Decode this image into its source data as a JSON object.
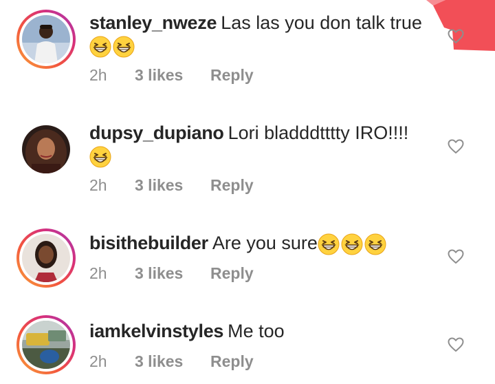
{
  "comments": [
    {
      "username": "stanley_nweze",
      "text": "Las las you don talk true",
      "emoji_count": 2,
      "time": "2h",
      "likes": "3 likes",
      "reply": "Reply",
      "avatar_ring": true
    },
    {
      "username": "dupsy_dupiano",
      "text": "Lori bladddtttty IRO!!!!",
      "emoji_count": 1,
      "time": "2h",
      "likes": "3 likes",
      "reply": "Reply",
      "avatar_ring": false
    },
    {
      "username": "bisithebuilder",
      "text": "Are you sure",
      "emoji_count": 3,
      "time": "2h",
      "likes": "3 likes",
      "reply": "Reply",
      "avatar_ring": true
    },
    {
      "username": "iamkelvinstyles",
      "text": "Me too",
      "emoji_count": 0,
      "time": "2h",
      "likes": "3 likes",
      "reply": "Reply",
      "avatar_ring": true
    }
  ],
  "icons": {
    "emoji": "grinning-squinting-face-icon",
    "like": "heart-outline-icon"
  },
  "colors": {
    "text": "#262626",
    "meta": "#8e8e8e",
    "heart": "#8e8e8e",
    "corner_mark": "#f0303a"
  }
}
